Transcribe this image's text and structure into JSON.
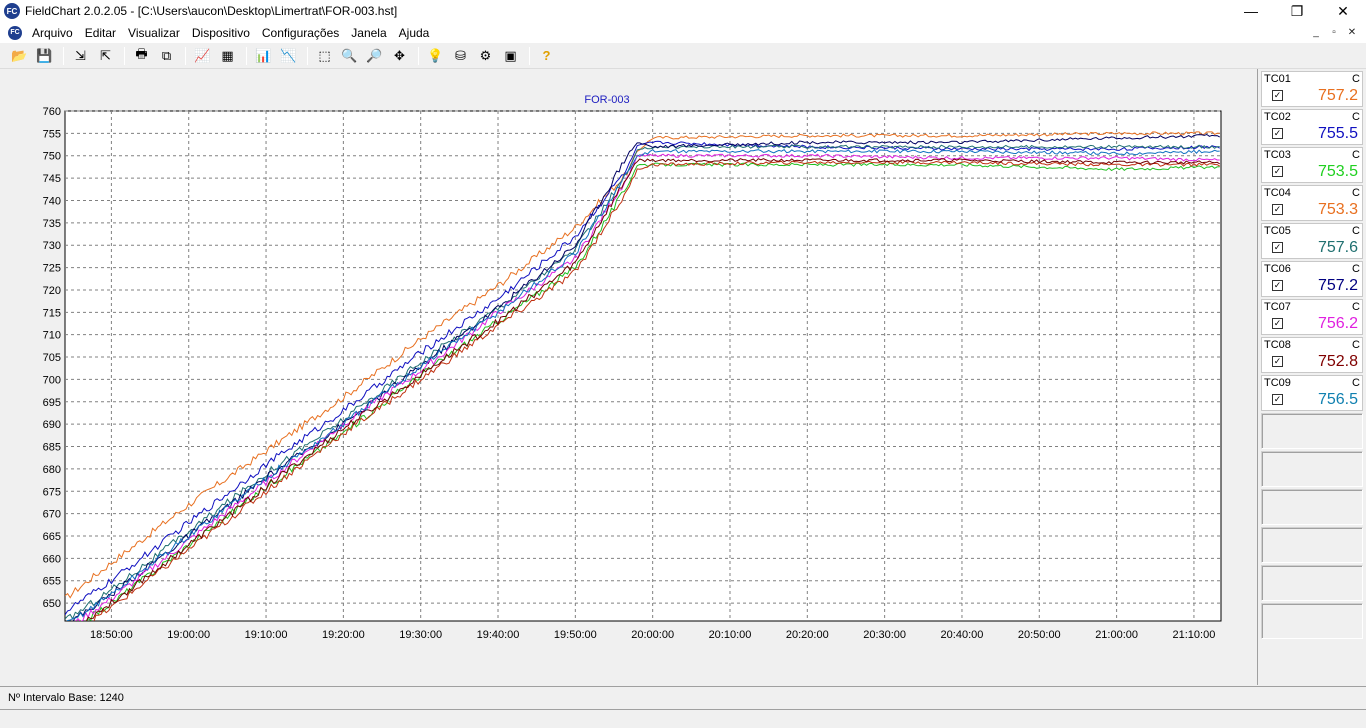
{
  "window": {
    "title": "FieldChart 2.0.2.05 - [C:\\Users\\aucon\\Desktop\\Limertrat\\FOR-003.hst]",
    "icon": "fc-logo-icon",
    "minimize_glyph": "—",
    "maximize_glyph": "❐",
    "close_glyph": "✕"
  },
  "menu": {
    "items": [
      "Arquivo",
      "Editar",
      "Visualizar",
      "Dispositivo",
      "Configurações",
      "Janela",
      "Ajuda"
    ],
    "mdi_glyphs": [
      "_",
      "▫",
      "✕"
    ]
  },
  "toolbar": {
    "groups": [
      [
        {
          "icon": "open-folder-icon",
          "glyph": "📂"
        },
        {
          "icon": "save-icon",
          "glyph": "💾"
        }
      ],
      [
        {
          "icon": "import-icon",
          "glyph": "⇲"
        },
        {
          "icon": "export-icon",
          "glyph": "⇱"
        }
      ],
      [
        {
          "icon": "print-icon",
          "glyph": "🖶"
        },
        {
          "icon": "copy-icon",
          "glyph": "⧉"
        }
      ],
      [
        {
          "icon": "chart-view-icon",
          "glyph": "📈"
        },
        {
          "icon": "table-view-icon",
          "glyph": "▦"
        }
      ],
      [
        {
          "icon": "chart-config-icon",
          "glyph": "📊"
        },
        {
          "icon": "chart-compare-icon",
          "glyph": "📉"
        }
      ],
      [
        {
          "icon": "zoom-area-icon",
          "glyph": "⬚"
        },
        {
          "icon": "zoom-in-icon",
          "glyph": "🔍"
        },
        {
          "icon": "zoom-out-icon",
          "glyph": "🔎"
        },
        {
          "icon": "pan-icon",
          "glyph": "✥"
        }
      ],
      [
        {
          "icon": "lightbulb-icon",
          "glyph": "💡"
        },
        {
          "icon": "device-icon",
          "glyph": "⛁"
        },
        {
          "icon": "network-icon",
          "glyph": "⚙"
        },
        {
          "icon": "monitor-icon",
          "glyph": "▣"
        }
      ],
      [
        {
          "icon": "help-icon",
          "glyph": "?"
        }
      ]
    ]
  },
  "chart_data": {
    "type": "line",
    "title": "FOR-003",
    "xlabel": "",
    "ylabel": "",
    "ylim": [
      646,
      760
    ],
    "yticks": [
      650,
      655,
      660,
      665,
      670,
      675,
      680,
      685,
      690,
      695,
      700,
      705,
      710,
      715,
      720,
      725,
      730,
      735,
      740,
      745,
      750,
      755,
      760
    ],
    "xlim": [
      "18:44:00",
      "21:13:30"
    ],
    "xticks": [
      "18:50:00",
      "19:00:00",
      "19:10:00",
      "19:20:00",
      "19:30:00",
      "19:40:00",
      "19:50:00",
      "20:00:00",
      "20:10:00",
      "20:20:00",
      "20:30:00",
      "20:40:00",
      "20:50:00",
      "21:00:00",
      "21:10:00"
    ],
    "grid": true,
    "x": [
      "18:44:00",
      "18:50:00",
      "19:00:00",
      "19:10:00",
      "19:20:00",
      "19:30:00",
      "19:40:00",
      "19:50:00",
      "19:56:40",
      "19:58:00",
      "20:00:00",
      "20:20:00",
      "20:40:00",
      "21:00:00",
      "21:13:30"
    ],
    "series": [
      {
        "color": "#e87020",
        "values": [
          651,
          659,
          672,
          684,
          696,
          709,
          721,
          734,
          746,
          751,
          754,
          754.5,
          754.5,
          755,
          755
        ]
      },
      {
        "color": "#1010c0",
        "values": [
          648,
          655,
          668,
          681,
          693,
          706,
          718,
          732,
          747,
          752,
          753,
          752,
          751.5,
          751.5,
          752
        ]
      },
      {
        "color": "#20c020",
        "values": [
          643,
          650,
          663,
          676,
          688,
          701,
          713,
          725,
          743,
          748,
          748,
          748,
          748,
          747,
          747.5
        ]
      },
      {
        "color": "#c03010",
        "values": [
          642,
          649,
          662,
          675,
          688,
          700,
          712,
          724,
          742,
          747,
          748,
          748.5,
          748.5,
          748,
          748
        ]
      },
      {
        "color": "#207070",
        "values": [
          646,
          653,
          666,
          679,
          691,
          704,
          716,
          729,
          746,
          751,
          752,
          752,
          752,
          752,
          752
        ]
      },
      {
        "color": "#000060",
        "values": [
          645,
          652,
          665,
          678,
          690,
          703,
          716,
          730,
          750,
          753,
          752,
          753,
          753,
          754,
          754.5
        ]
      },
      {
        "color": "#e020e0",
        "values": [
          644,
          651,
          664,
          677,
          690,
          702,
          715,
          727,
          745,
          750,
          750,
          750,
          749.5,
          749.5,
          749
        ]
      },
      {
        "color": "#700000",
        "values": [
          643,
          650,
          663,
          676,
          689,
          701,
          713,
          726,
          745,
          749,
          749,
          749,
          749,
          748.5,
          748.5
        ]
      },
      {
        "color": "#1070c0",
        "values": [
          645,
          652,
          665,
          678,
          690,
          703,
          715,
          728,
          746,
          750,
          751,
          751,
          751,
          750.5,
          751
        ]
      }
    ]
  },
  "channels": [
    {
      "name": "TC01",
      "unit": "C",
      "value": "757.2",
      "checked": true,
      "color": "#e87020"
    },
    {
      "name": "TC02",
      "unit": "C",
      "value": "755.5",
      "checked": true,
      "color": "#1010c0"
    },
    {
      "name": "TC03",
      "unit": "C",
      "value": "753.5",
      "checked": true,
      "color": "#20d020"
    },
    {
      "name": "TC04",
      "unit": "C",
      "value": "753.3",
      "checked": true,
      "color": "#e87020"
    },
    {
      "name": "TC05",
      "unit": "C",
      "value": "757.6",
      "checked": true,
      "color": "#207070"
    },
    {
      "name": "TC06",
      "unit": "C",
      "value": "757.2",
      "checked": true,
      "color": "#000080"
    },
    {
      "name": "TC07",
      "unit": "C",
      "value": "756.2",
      "checked": true,
      "color": "#e020e0"
    },
    {
      "name": "TC08",
      "unit": "C",
      "value": "752.8",
      "checked": true,
      "color": "#800000"
    },
    {
      "name": "TC09",
      "unit": "C",
      "value": "756.5",
      "checked": true,
      "color": "#1080b0"
    }
  ],
  "empty_channel_slots": 6,
  "checkmark_glyph": "✓",
  "status": {
    "base_interval": "Nº Intervalo Base: 1240"
  }
}
